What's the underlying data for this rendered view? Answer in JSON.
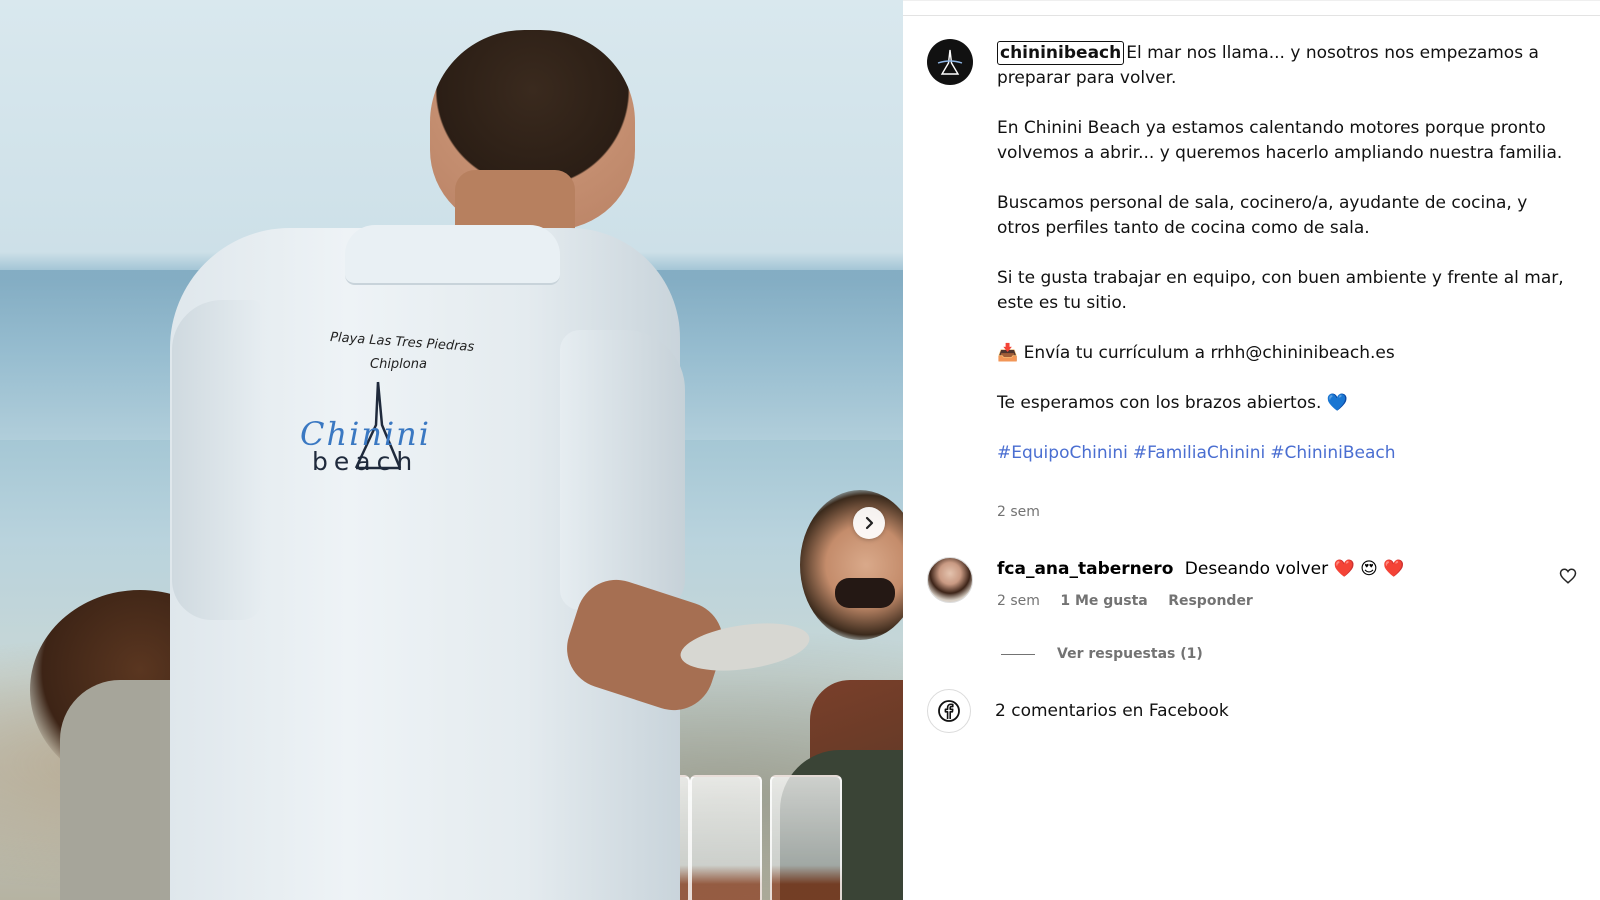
{
  "media": {
    "shirt_print": {
      "line1": "Playa Las Tres Piedras",
      "line2": "Chiplona",
      "brand": "Chinini",
      "sub": "beach"
    },
    "next_icon": "chevron-right-icon"
  },
  "post": {
    "username": "chininibeach",
    "caption_line1": "El mar nos llama... y nosotros nos empezamos a preparar para volver.",
    "para2": "En Chinini Beach ya estamos calentando motores porque pronto volvemos a abrir... y queremos hacerlo ampliando nuestra familia.",
    "para3": "Buscamos personal de sala, cocinero/a, ayudante de cocina, y otros perfiles tanto de cocina como de sala.",
    "para4": "Si te gusta trabajar en equipo, con buen ambiente y frente al mar, este es tu sitio.",
    "para5_emoji": "📥",
    "para5": "Envía tu currículum a rrhh@chininibeach.es",
    "para6": "Te esperamos con los brazos abiertos.",
    "para6_emoji": "💙",
    "hashtags": [
      "#EquipoChinini",
      "#FamiliaChinini",
      "#ChininiBeach"
    ],
    "time": "2 sem"
  },
  "comment": {
    "username": "fca_ana_tabernero",
    "text": "Deseando volver",
    "emojis": "❤️ 😍 ❤️",
    "time": "2 sem",
    "likes": "1 Me gusta",
    "reply": "Responder",
    "view_replies": "Ver respuestas (1)"
  },
  "facebook": {
    "label": "2 comentarios en Facebook",
    "icon": "facebook-icon"
  },
  "colors": {
    "hashtag": "#4a6ed1",
    "meta": "#737373",
    "shirt_brand": "#3a78c2"
  }
}
